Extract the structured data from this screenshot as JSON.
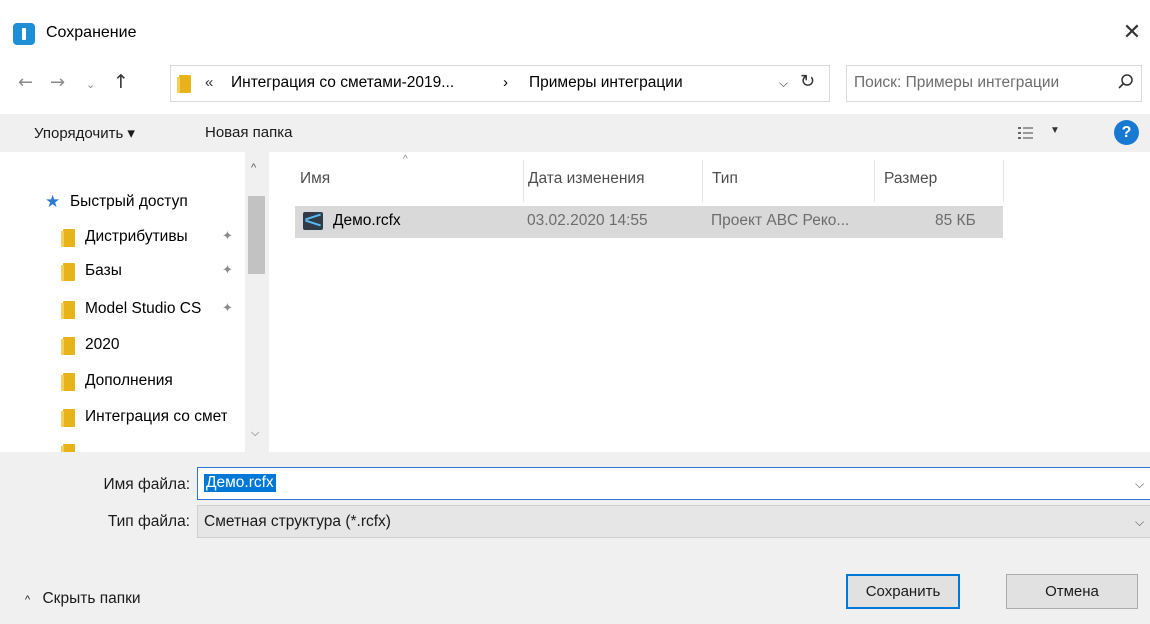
{
  "window": {
    "title": "Сохранение",
    "close": "✕"
  },
  "nav": {
    "back": "←",
    "forward": "→",
    "recent": "⌄",
    "up": "↑"
  },
  "address": {
    "overflow": "«",
    "crumbs": [
      "Интеграция со сметами-2019...",
      "Примеры интеграции"
    ],
    "separator": "›",
    "dropdown": "⌵",
    "refresh": "↻"
  },
  "search": {
    "placeholder": "Поиск: Примеры интеграции"
  },
  "toolbar": {
    "organize_label": "Упорядочить ▾",
    "new_folder_label": "Новая папка",
    "view_dropdown": "▼",
    "help_label": "?"
  },
  "sidebar": {
    "quick_access": "Быстрый доступ",
    "items": [
      {
        "label": "Дистрибутивы",
        "pinned": true
      },
      {
        "label": "Базы",
        "pinned": true
      },
      {
        "label": "Model Studio CS",
        "pinned": true
      },
      {
        "label": "2020",
        "pinned": false
      },
      {
        "label": "Дополнения",
        "pinned": false
      },
      {
        "label": "Интеграция со сметами",
        "pinned": false
      }
    ],
    "pin_glyph": "✦",
    "scroll_up": "^",
    "scroll_down": "⌵"
  },
  "columns": {
    "sort_arrow": "^",
    "name": "Имя",
    "date": "Дата изменения",
    "type": "Тип",
    "size": "Размер"
  },
  "files": [
    {
      "name": "Демо.rcfx",
      "date": "03.02.2020 14:55",
      "type": "Проект ABC Реко...",
      "size": "85 КБ"
    }
  ],
  "form": {
    "filename_label": "Имя файла:",
    "filename_value": "Демо.rcfx",
    "filetype_label": "Тип файла:",
    "filetype_value": "Сметная структура (*.rcfx)",
    "dropdown": "⌵"
  },
  "footer": {
    "hide_folders_chevron": "^",
    "hide_folders_label": "Скрыть папки",
    "save_label": "Сохранить",
    "cancel_label": "Отмена"
  },
  "colors": {
    "accent": "#0078d7",
    "selection": "#d9d9d9",
    "panel": "#f0f0f0",
    "folder": "#e8b31a",
    "quick_access_star": "#2b7bd1"
  }
}
